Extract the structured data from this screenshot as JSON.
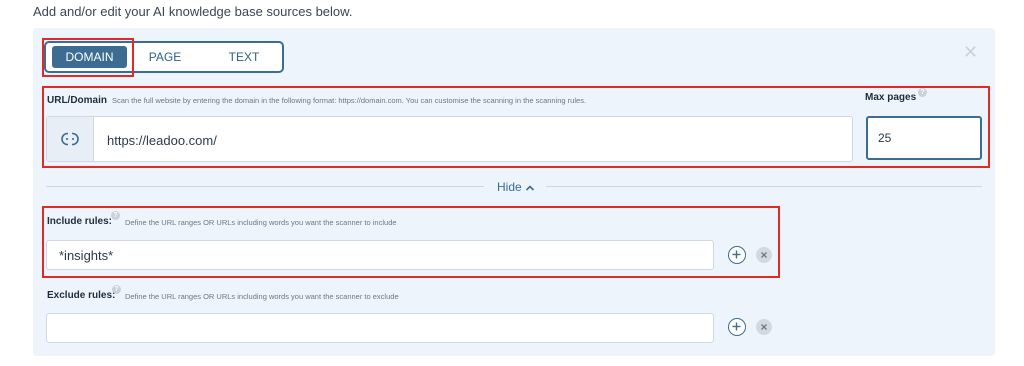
{
  "intro_text": "Add and/or edit your AI knowledge base sources below.",
  "tabs": [
    {
      "label": "DOMAIN",
      "active": true
    },
    {
      "label": "PAGE",
      "active": false
    },
    {
      "label": "TEXT",
      "active": false
    }
  ],
  "url_domain": {
    "label": "URL/Domain",
    "hint": "Scan the full website by entering the domain in the following format: https://domain.com. You can customise the scanning in the scanning rules.",
    "value": "https://leadoo.com/",
    "icon": "link-icon"
  },
  "max_pages": {
    "label": "Max pages",
    "value": "25"
  },
  "hide_toggle": {
    "label": "Hide",
    "icon": "chevron-up-icon"
  },
  "include_rules": {
    "label": "Include rules:",
    "hint": "Define the URL ranges OR URLs including words you want the scanner to include",
    "value": "*insights*"
  },
  "exclude_rules": {
    "label": "Exclude rules:",
    "hint": "Define the URL ranges OR URLs including words you want the scanner to exclude",
    "value": ""
  },
  "colors": {
    "accent": "#3d6c92",
    "panel_bg": "#edf4fc",
    "highlight": "#e02a26"
  }
}
